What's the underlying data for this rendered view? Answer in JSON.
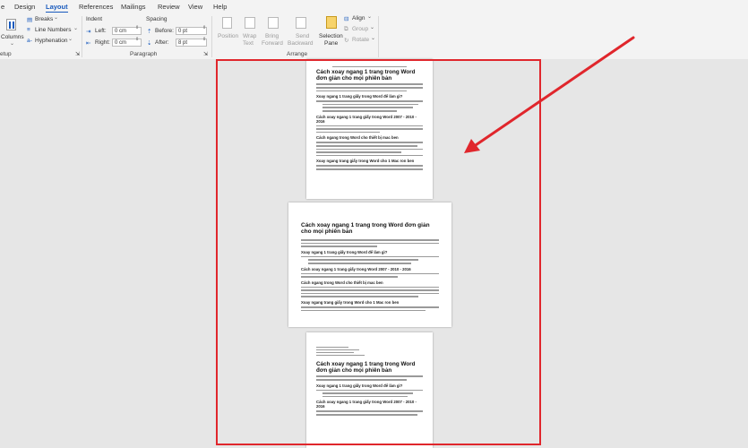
{
  "tabs": [
    "e",
    "Design",
    "Layout",
    "References",
    "Mailings",
    "Review",
    "View",
    "Help"
  ],
  "ribbon": {
    "setup_label": "etup",
    "columns_label": "Columns",
    "breaks_label": "Breaks",
    "line_numbers_label": "Line Numbers",
    "hyphenation_label": "Hyphenation",
    "indent": {
      "title": "Indent",
      "left_label": "Left:",
      "left_value": "0 cm",
      "right_label": "Right:",
      "right_value": "0 cm"
    },
    "spacing": {
      "title": "Spacing",
      "before_label": "Before:",
      "before_value": "0 pt",
      "after_label": "After:",
      "after_value": "8 pt"
    },
    "paragraph_label": "Paragraph",
    "arrange": {
      "label": "Arrange",
      "position": "Position",
      "wrap_1": "Wrap",
      "wrap_2": "Text",
      "bring_1": "Bring",
      "bring_2": "Forward",
      "send_1": "Send",
      "send_2": "Backward",
      "selection_1": "Selection",
      "selection_2": "Pane",
      "align": "Align",
      "group": "Group",
      "rotate": "Rotate"
    }
  },
  "document": {
    "title": "Cách xoay ngang 1 trang trong Word đơn giản cho mọi phiên bản",
    "heading_1": "Xoay ngang 1 trang giấy trong Word để làm gì?",
    "heading_2": "Cách xoay ngang 1 trang giấy trong Word 2007 - 2010 - 2016",
    "heading_3": "Cách ngang trong Word cho thiết bị mac ben",
    "heading_4": "Xoay ngang trang giấy trong Word cho 1 Mac ron ben"
  },
  "colors": {
    "highlight_box": "#e0262c",
    "arrow": "#e0262c",
    "accent": "#185abd"
  }
}
